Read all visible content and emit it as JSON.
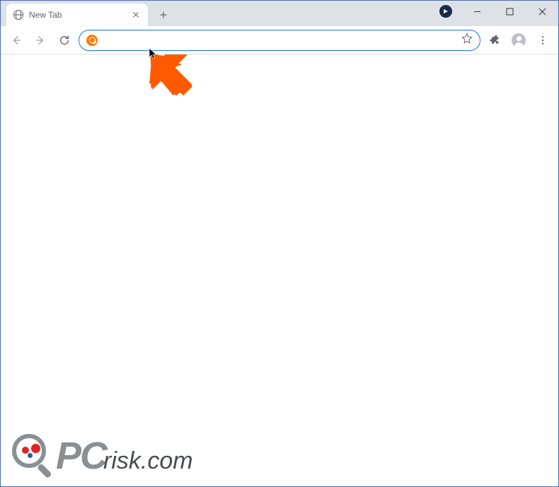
{
  "tab": {
    "title": "New Tab"
  },
  "omnibox": {
    "value": "",
    "placeholder": ""
  },
  "watermark": {
    "pc": "PC",
    "risk": "risk.com"
  }
}
